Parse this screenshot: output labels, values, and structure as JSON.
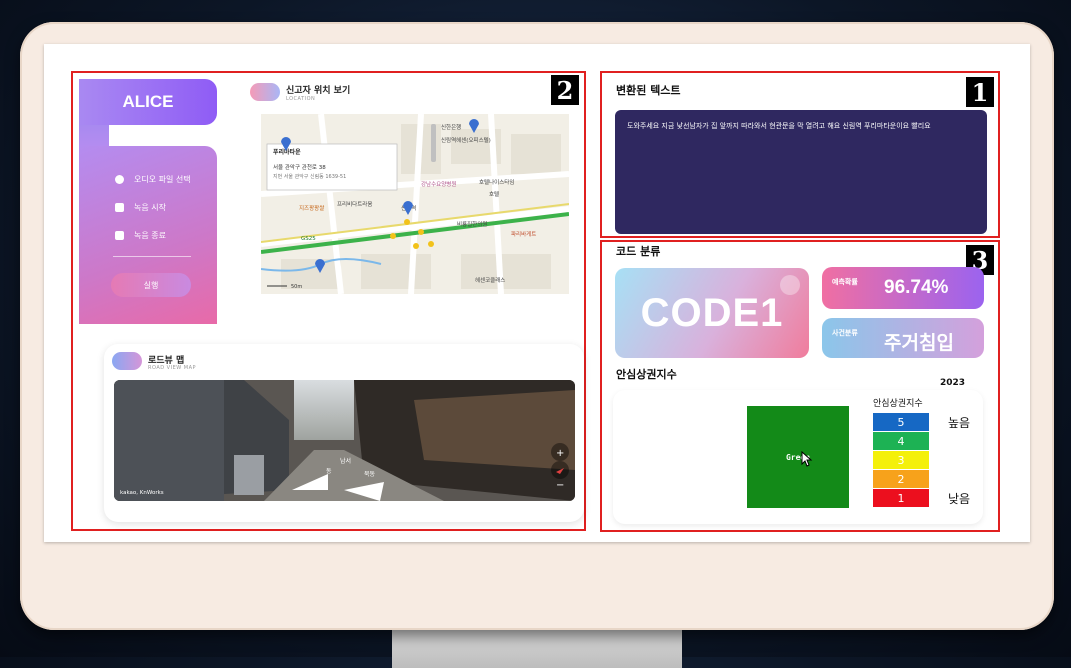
{
  "sidebar": {
    "app_title": "ALICE",
    "items": [
      {
        "label": "오디오 파일 선택",
        "icon": "clock-icon"
      },
      {
        "label": "녹음 시작",
        "icon": "save-icon"
      },
      {
        "label": "녹음 종료",
        "icon": "calendar-icon"
      }
    ],
    "run_label": "실행"
  },
  "location": {
    "title": "신고자 위치 보기",
    "subtitle": "LOCATION",
    "map": {
      "popup_title": "푸리마타운",
      "popup_addr1": "서울 관악구 관천로 38",
      "popup_addr2": "지번 서울 관악구 신림동 1639-51",
      "labels": [
        "신한은행",
        "신림역헤센(오피스텔)",
        "호텔나이스타임",
        "강남수요양병원",
        "호텔",
        "파리바게트",
        "비룡집한의원",
        "지즈팡팡쌀",
        "프리비다트라움",
        "GS25",
        "신림역",
        "헤센코클래스"
      ],
      "scale": "50m"
    }
  },
  "roadview": {
    "title": "로드뷰 맵",
    "subtitle": "ROAD VIEW MAP",
    "watermark": "kakao, KnWorks",
    "dir_labels": [
      "남서",
      "북동",
      "동"
    ],
    "zoom_in": "+",
    "zoom_out": "−"
  },
  "panel_numbers": {
    "p1": "1",
    "p2": "2",
    "p3": "3"
  },
  "converted": {
    "title": "변환된 텍스트",
    "text": "도와주세요 지금 낯선남자가 집 앞까지 따라와서 현관문을 막 열려고 해요 신림역 푸리마타운이요 빨리요"
  },
  "classification": {
    "title": "코드 분류",
    "code": "CODE1",
    "prob_label": "예측확률",
    "prob_value": "96.74%",
    "type_label": "사건분류",
    "type_value": "주거침입"
  },
  "safety_index": {
    "title": "안심상권지수",
    "year": "2023",
    "current": "Green",
    "legend_title": "안심상권지수",
    "legend": [
      {
        "label": "5",
        "color": "#1668c4"
      },
      {
        "label": "4",
        "color": "#1db254"
      },
      {
        "label": "3",
        "color": "#f4f00a"
      },
      {
        "label": "2",
        "color": "#f7a21b"
      },
      {
        "label": "1",
        "color": "#ec0f1e"
      }
    ],
    "high": "높음",
    "low": "낮음"
  },
  "colors": {
    "frame": "#e02020",
    "text_bg": "#2f2860",
    "accent": "#8f5cf5"
  }
}
